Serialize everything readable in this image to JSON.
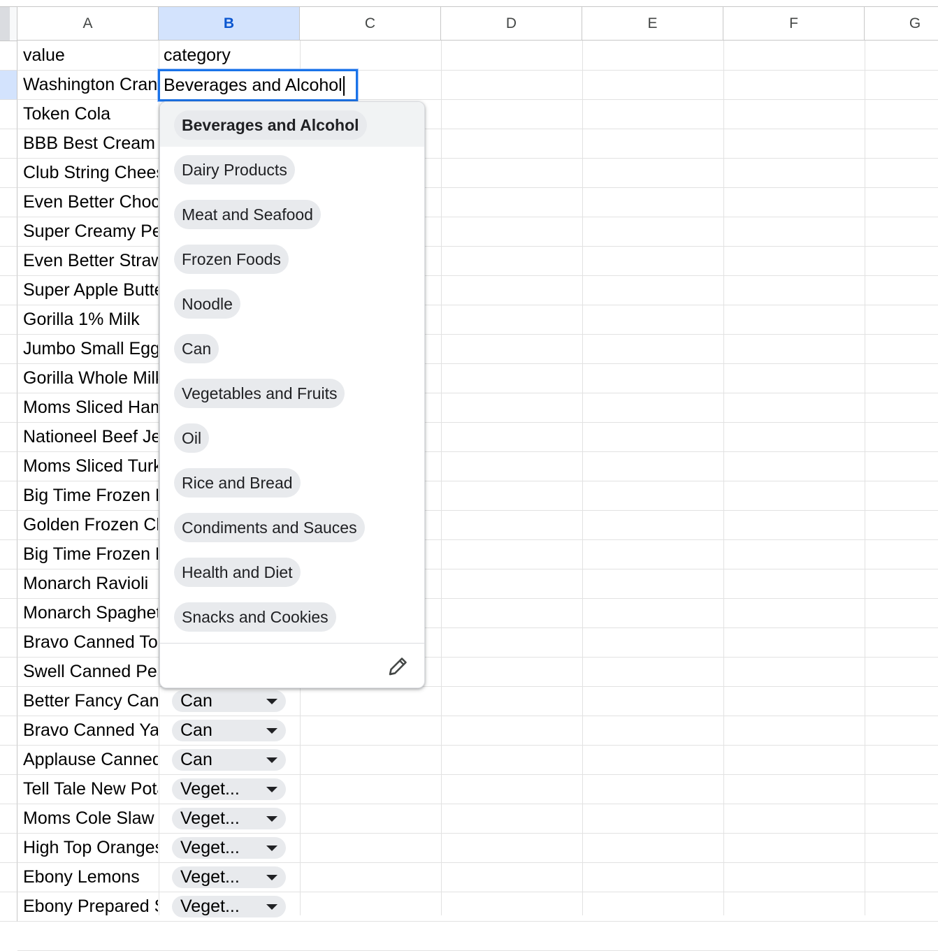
{
  "columns": [
    {
      "label": "A",
      "selected": false
    },
    {
      "label": "B",
      "selected": true
    },
    {
      "label": "C",
      "selected": false
    },
    {
      "label": "D",
      "selected": false
    },
    {
      "label": "E",
      "selected": false
    },
    {
      "label": "F",
      "selected": false
    },
    {
      "label": "G",
      "selected": false
    }
  ],
  "header_row": {
    "a": "value",
    "b": "category"
  },
  "active_cell": {
    "column": "B",
    "value": "Beverages and Alcohol"
  },
  "column_a": [
    "Washington Cranberry Juice",
    "Token Cola",
    "BBB Best Cream Cheese",
    "Club String Cheese",
    "Even Better Chocolate Milk",
    "Super Creamy Peanut Butter",
    "Even Better Strawberry Yogurt",
    "Super Apple Butter",
    "Gorilla 1% Milk",
    "Jumbo Small Eggs",
    "Gorilla Whole Milk",
    "Moms Sliced Ham",
    "Nationeel Beef Jerky",
    "Moms Sliced Turkey",
    "Big Time Frozen Pizza",
    "Golden Frozen Chicken",
    "Big Time Frozen Peas",
    "Monarch Ravioli",
    "Monarch Spaghetti",
    "Bravo Canned Tomatoes",
    "Swell Canned Peaches",
    "Better Fancy Canned Sardines",
    "Bravo Canned Yams",
    "Applause Canned Mixed Fruit",
    "Tell Tale New Potatos",
    "Moms Cole Slaw",
    "High Top Oranges",
    "Ebony Lemons",
    "Ebony Prepared Salad"
  ],
  "column_b_visible": [
    {
      "row_index": 21,
      "value": "Can"
    },
    {
      "row_index": 22,
      "value": "Can"
    },
    {
      "row_index": 23,
      "value": "Can"
    },
    {
      "row_index": 24,
      "value": "Veget..."
    },
    {
      "row_index": 25,
      "value": "Veget..."
    },
    {
      "row_index": 26,
      "value": "Veget..."
    },
    {
      "row_index": 27,
      "value": "Veget..."
    },
    {
      "row_index": 28,
      "value": "Veget..."
    }
  ],
  "dropdown": {
    "highlighted_index": 0,
    "options": [
      "Beverages and Alcohol",
      "Dairy Products",
      "Meat and Seafood",
      "Frozen Foods",
      "Noodle",
      "Can",
      "Vegetables and Fruits",
      "Oil",
      "Rice and Bread",
      "Condiments and Sauces",
      "Health and Diet",
      "Snacks and Cookies"
    ],
    "edit_icon": "pencil-icon"
  },
  "colors": {
    "selection_header": "#d3e3fd",
    "active_border": "#1a73e8",
    "chip_bg": "#e8eaed",
    "grid": "#e2e2e2"
  }
}
